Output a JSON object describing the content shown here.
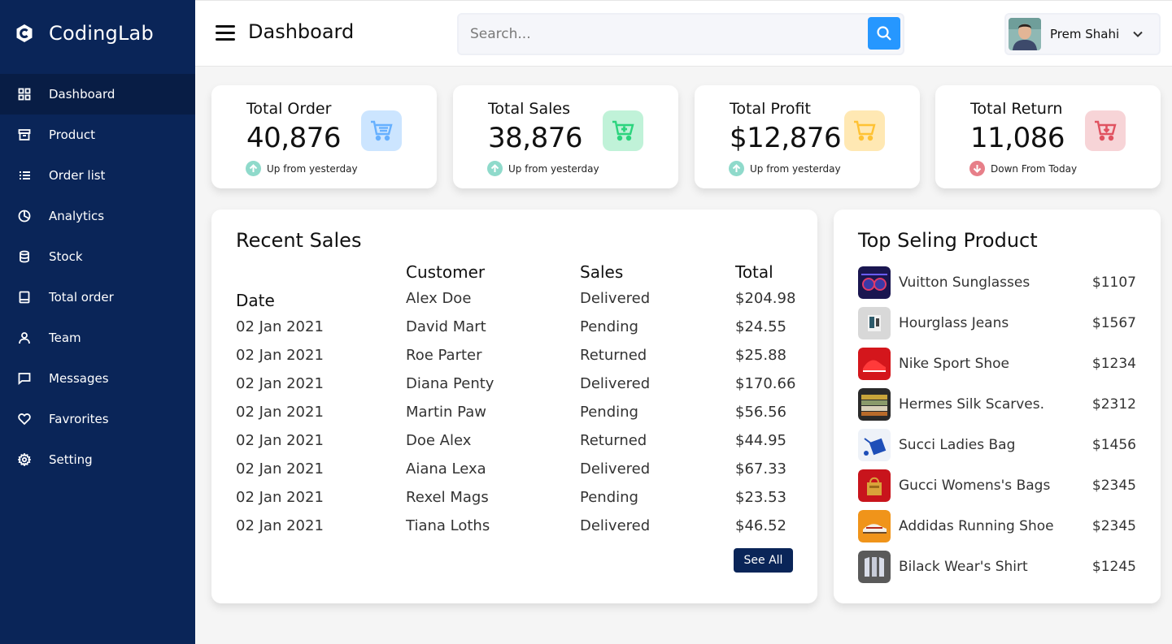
{
  "brand": {
    "name": "CodingLab"
  },
  "sidebar": {
    "items": [
      {
        "label": "Dashboard",
        "icon": "grid-icon",
        "active": true
      },
      {
        "label": "Product",
        "icon": "box-icon"
      },
      {
        "label": "Order list",
        "icon": "list-icon"
      },
      {
        "label": "Analytics",
        "icon": "pie-chart-icon"
      },
      {
        "label": "Stock",
        "icon": "database-icon"
      },
      {
        "label": "Total order",
        "icon": "book-icon"
      },
      {
        "label": "Team",
        "icon": "user-icon"
      },
      {
        "label": "Messages",
        "icon": "message-icon"
      },
      {
        "label": "Favrorites",
        "icon": "heart-icon"
      },
      {
        "label": "Setting",
        "icon": "cog-icon"
      }
    ]
  },
  "header": {
    "title": "Dashboard",
    "search_placeholder": "Search...",
    "user_name": "Prem Shahi"
  },
  "stats": [
    {
      "title": "Total Order",
      "value": "40,876",
      "indicator": "Up from yesterday",
      "direction": "up",
      "icon_bg": "#cce5ff",
      "icon_color": "#66b0ff"
    },
    {
      "title": "Total Sales",
      "value": "38,876",
      "indicator": "Up from yesterday",
      "direction": "up",
      "icon_bg": "#c0f2d8",
      "icon_color": "#2bd47d"
    },
    {
      "title": "Total Profit",
      "value": "$12,876",
      "indicator": "Up from yesterday",
      "direction": "up",
      "icon_bg": "#ffe8b3",
      "icon_color": "#ffc233"
    },
    {
      "title": "Total Return",
      "value": "11,086",
      "indicator": "Down From Today",
      "direction": "down",
      "icon_bg": "#f7d4d7",
      "icon_color": "#e05260"
    }
  ],
  "recent_sales": {
    "title": "Recent Sales",
    "headers": {
      "date": "Date",
      "customer": "Customer",
      "sales": "Sales",
      "total": "Total"
    },
    "dates": [
      "02 Jan 2021",
      "02 Jan 2021",
      "02 Jan 2021",
      "02 Jan 2021",
      "02 Jan 2021",
      "02 Jan 2021",
      "02 Jan 2021",
      "02 Jan 2021"
    ],
    "customers": [
      "Alex Doe",
      "David Mart",
      "Roe Parter",
      "Diana Penty",
      "Martin Paw",
      "Doe Alex",
      "Aiana Lexa",
      "Rexel Mags",
      "Tiana Loths"
    ],
    "sales": [
      "Delivered",
      "Pending",
      "Returned",
      "Delivered",
      "Pending",
      "Returned",
      "Delivered",
      "Pending",
      "Delivered"
    ],
    "totals": [
      "$204.98",
      "$24.55",
      "$25.88",
      "$170.66",
      "$56.56",
      "$44.95",
      "$67.33",
      "$23.53",
      "$46.52"
    ],
    "see_all_label": "See All"
  },
  "top_selling": {
    "title": "Top Seling Product",
    "items": [
      {
        "name": "Vuitton Sunglasses",
        "price": "$1107"
      },
      {
        "name": "Hourglass Jeans",
        "price": "$1567"
      },
      {
        "name": "Nike Sport Shoe",
        "price": "$1234"
      },
      {
        "name": "Hermes Silk Scarves.",
        "price": "$2312"
      },
      {
        "name": "Succi Ladies Bag",
        "price": "$1456"
      },
      {
        "name": "Gucci Womens's Bags",
        "price": "$2345"
      },
      {
        "name": "Addidas Running Shoe",
        "price": "$2345"
      },
      {
        "name": "Bilack Wear's Shirt",
        "price": "$1245"
      }
    ]
  }
}
